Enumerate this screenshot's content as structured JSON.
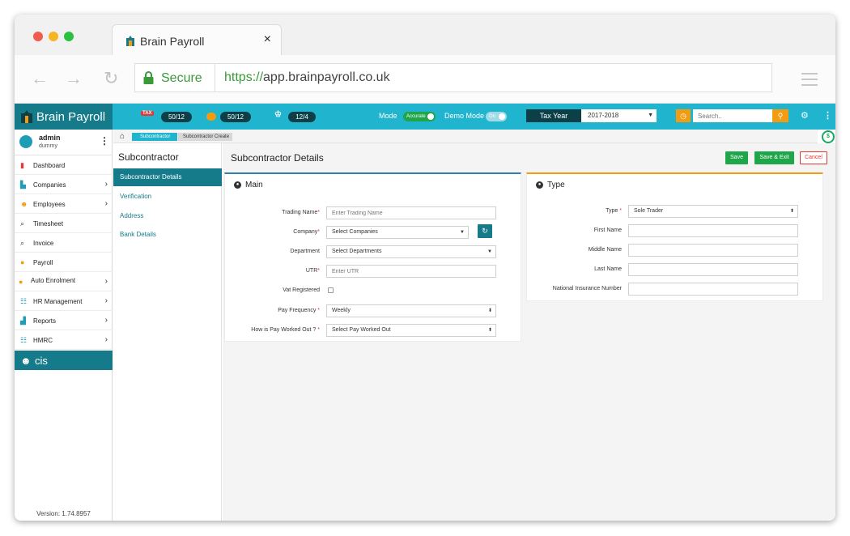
{
  "browser": {
    "tab_title": "Brain Payroll",
    "tab_close": "×",
    "secure_label": "Secure",
    "url_protocol": "https://",
    "url_rest": "app.brainpayroll.co.uk"
  },
  "topbar": {
    "brand": "Brain Payroll",
    "tax_badge": "TAX",
    "counter1": "50/12",
    "counter2": "50/12",
    "counter3": "12/4",
    "mode_label": "Mode",
    "mode_toggle": "Accurate",
    "demo_label": "Demo Mode",
    "demo_toggle": "On",
    "tax_year_label": "Tax Year",
    "tax_year_value": "2017-2018",
    "search_placeholder": "Search..",
    "colors": {
      "bar": "#20b4cf",
      "dark": "#157b8a",
      "accent": "#f39c12"
    }
  },
  "user": {
    "name": "admin",
    "sub": "dummy"
  },
  "sidebar": {
    "items": [
      {
        "label": "Dashboard",
        "icon": "bar-chart-icon",
        "chevron": false
      },
      {
        "label": "Companies",
        "icon": "buildings-icon",
        "chevron": true
      },
      {
        "label": "Employees",
        "icon": "people-icon",
        "chevron": true
      },
      {
        "label": "Timesheet",
        "icon": "timesheet-icon",
        "chevron": false
      },
      {
        "label": "Invoice",
        "icon": "invoice-icon",
        "chevron": false
      },
      {
        "label": "Payroll",
        "icon": "money-bag-icon",
        "chevron": false
      },
      {
        "label": "Auto Enrolment",
        "icon": "coins-icon",
        "chevron": true
      },
      {
        "label": "HR Management",
        "icon": "team-icon",
        "chevron": true
      },
      {
        "label": "Reports",
        "icon": "report-icon",
        "chevron": true
      },
      {
        "label": "HMRC",
        "icon": "hmrc-icon",
        "chevron": true
      }
    ],
    "cis_label": "cis",
    "version": "Version: 1.74.8957"
  },
  "breadcrumb": {
    "item1": "Subcontractor",
    "item2": "Subcontractor Create"
  },
  "subnav": {
    "title": "Subcontractor",
    "items": [
      "Subcontractor Details",
      "Verification",
      "Address",
      "Bank Details"
    ]
  },
  "content": {
    "title": "Subcontractor Details",
    "save": "Save",
    "save_exit": "Save & Exit",
    "cancel": "Cancel"
  },
  "main_panel": {
    "title": "Main",
    "trading_name": {
      "label": "Trading Name",
      "placeholder": "Enter Trading Name"
    },
    "company": {
      "label": "Company",
      "value": "Select Companies"
    },
    "department": {
      "label": "Department",
      "value": "Select Departments"
    },
    "utr": {
      "label": "UTR",
      "placeholder": "Enter UTR"
    },
    "vat": {
      "label": "Vat Registered"
    },
    "pay_frequency": {
      "label": "Pay Frequency ",
      "value": "Weekly"
    },
    "pay_worked": {
      "label": "How is Pay Worked Out ? ",
      "value": "Select Pay Worked Out"
    }
  },
  "type_panel": {
    "title": "Type",
    "type": {
      "label": "Type ",
      "value": "Sole Trader"
    },
    "first_name": {
      "label": "First Name"
    },
    "middle_name": {
      "label": "Middle Name"
    },
    "last_name": {
      "label": "Last Name"
    },
    "ni_number": {
      "label": "National Insurance Number"
    }
  }
}
